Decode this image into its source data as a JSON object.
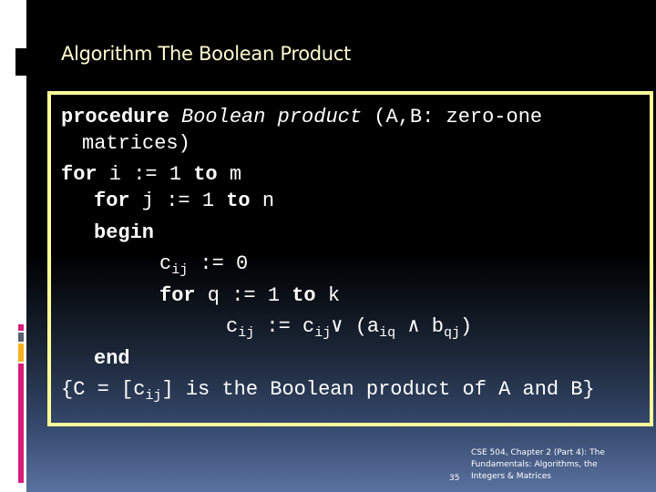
{
  "slide": {
    "title": "Algorithm The Boolean Product",
    "code": {
      "line1": {
        "kw": "procedure",
        "name": "Boolean product",
        "rest": " (A,B: zero-one"
      },
      "line2": "matrices)",
      "line3": {
        "kw1": "for",
        "mid1": " i := 1 ",
        "kw2": "to",
        "mid2": " m"
      },
      "line4": {
        "kw1": "for",
        "mid1": " j := 1 ",
        "kw2": "to",
        "mid2": " n"
      },
      "line5": "begin",
      "line6": {
        "var": "c",
        "sub": "ij",
        "rest": " := 0"
      },
      "line7": {
        "kw1": "for",
        "mid1": " q := 1 ",
        "kw2": "to",
        "mid2": " k"
      },
      "line8": {
        "var1": "c",
        "sub1": "ij",
        "op": " := c",
        "sub2": "ij",
        "or": "∨ (a",
        "sub3": "iq",
        "and": " ∧ b",
        "sub4": "qj",
        "close": ")"
      },
      "line9": "end",
      "line10": {
        "pre": "{C = [c",
        "sub": "ij",
        "post": "] is the Boolean product of A and B}"
      }
    },
    "footer": {
      "page_number": "35",
      "course_text": "CSE 504, Chapter 2 (Part 4): The Fundamentals: Algorithms, the Integers & Matrices"
    }
  },
  "colors": {
    "box_border": "#ffff99",
    "title_text": "#fffcd0",
    "accent_pink": "#d81b7a",
    "accent_orange": "#f5b21e",
    "accent_grey": "#5a6270"
  }
}
